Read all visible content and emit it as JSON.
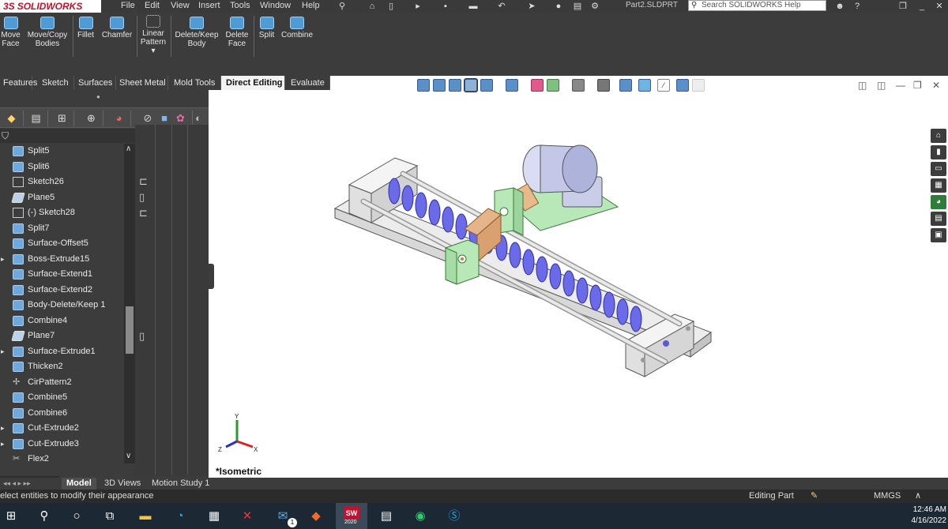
{
  "app": {
    "brand": "SOLIDWORKS",
    "brand_prefix": "3S",
    "document_title": "Part2.SLDPRT",
    "help_search_placeholder": "Search SOLIDWORKS Help"
  },
  "menu": [
    "File",
    "Edit",
    "View",
    "Insert",
    "Tools",
    "Window",
    "Help"
  ],
  "commands": [
    {
      "label1": "Move",
      "label2": "Face"
    },
    {
      "label1": "Move/Copy",
      "label2": "Bodies"
    },
    {
      "label1": "Fillet",
      "label2": ""
    },
    {
      "label1": "Chamfer",
      "label2": ""
    },
    {
      "label1": "Linear",
      "label2": "Pattern"
    },
    {
      "label1": "Delete/Keep",
      "label2": "Body"
    },
    {
      "label1": "Delete",
      "label2": "Face"
    },
    {
      "label1": "Split",
      "label2": ""
    },
    {
      "label1": "Combine",
      "label2": ""
    }
  ],
  "tabs": [
    "Features",
    "Sketch",
    "Surfaces",
    "Sheet Metal",
    "Mold Tools",
    "Direct Editing",
    "Evaluate"
  ],
  "active_tab": "Direct Editing",
  "feature_tree": [
    {
      "label": "Split5",
      "icon": "body-icon"
    },
    {
      "label": "Split6",
      "icon": "body-icon"
    },
    {
      "label": "Sketch26",
      "icon": "sketch-icon"
    },
    {
      "label": "Plane5",
      "icon": "plane-icon"
    },
    {
      "label": "(-) Sketch28",
      "icon": "sketch-icon"
    },
    {
      "label": "Split7",
      "icon": "body-icon"
    },
    {
      "label": "Surface-Offset5",
      "icon": "surface-icon"
    },
    {
      "label": "Boss-Extrude15",
      "icon": "extrude-icon"
    },
    {
      "label": "Surface-Extend1",
      "icon": "surface-icon"
    },
    {
      "label": "Surface-Extend2",
      "icon": "surface-icon"
    },
    {
      "label": "Body-Delete/Keep 1",
      "icon": "body-icon"
    },
    {
      "label": "Combine4",
      "icon": "combine-icon"
    },
    {
      "label": "Plane7",
      "icon": "plane-icon"
    },
    {
      "label": "Surface-Extrude1",
      "icon": "surface-icon"
    },
    {
      "label": "Thicken2",
      "icon": "thicken-icon"
    },
    {
      "label": "CirPattern2",
      "icon": "pattern-icon"
    },
    {
      "label": "Combine5",
      "icon": "combine-icon"
    },
    {
      "label": "Combine6",
      "icon": "combine-icon"
    },
    {
      "label": "Cut-Extrude2",
      "icon": "cut-icon"
    },
    {
      "label": "Cut-Extrude3",
      "icon": "cut-icon"
    },
    {
      "label": "Flex2",
      "icon": "flex-icon"
    }
  ],
  "view_orientation": "*Isometric",
  "bottom_tabs": [
    "Model",
    "3D Views",
    "Motion Study 1"
  ],
  "status": {
    "message": "elect entities to modify their appearance",
    "mode": "Editing Part",
    "units": "MMGS"
  },
  "taskbar": {
    "time": "12:46 AM",
    "date": "4/16/2022",
    "mail_badge": "1",
    "solidworks_badge": "2020"
  },
  "triad": {
    "x": "X",
    "y": "Y",
    "z": "Z"
  }
}
